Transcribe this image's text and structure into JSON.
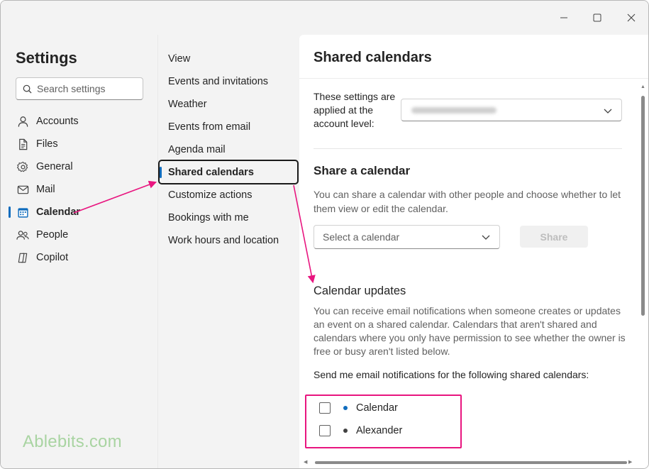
{
  "window": {
    "controls": [
      "minimize",
      "maximize",
      "close"
    ]
  },
  "settings": {
    "title": "Settings",
    "search_placeholder": "Search settings"
  },
  "nav": {
    "items": [
      {
        "label": "Accounts",
        "icon": "person-icon"
      },
      {
        "label": "Files",
        "icon": "file-icon"
      },
      {
        "label": "General",
        "icon": "gear-icon"
      },
      {
        "label": "Mail",
        "icon": "mail-icon"
      },
      {
        "label": "Calendar",
        "icon": "calendar-icon",
        "active": true
      },
      {
        "label": "People",
        "icon": "people-icon"
      },
      {
        "label": "Copilot",
        "icon": "copilot-icon"
      }
    ]
  },
  "subnav": {
    "items": [
      {
        "label": "View"
      },
      {
        "label": "Events and invitations"
      },
      {
        "label": "Weather"
      },
      {
        "label": "Events from email"
      },
      {
        "label": "Agenda mail"
      },
      {
        "label": "Shared calendars",
        "active": true
      },
      {
        "label": "Customize actions"
      },
      {
        "label": "Bookings with me"
      },
      {
        "label": "Work hours and location"
      }
    ]
  },
  "content": {
    "title": "Shared calendars",
    "account_label": "These settings are applied at the account level:",
    "share_heading": "Share a calendar",
    "share_text": "You can share a calendar with other people and choose whether to let them view or edit the calendar.",
    "select_placeholder": "Select a calendar",
    "share_button": "Share",
    "updates_heading": "Calendar updates",
    "updates_text": "You can receive email notifications when someone creates or updates an event on a shared calendar. Calendars that aren't shared and calendars where you only have permission to see whether the owner is free or busy aren't listed below.",
    "send_label": "Send me email notifications for the following shared calendars:",
    "calendars": [
      {
        "name": "Calendar",
        "color": "#0f6cbd",
        "checked": false
      },
      {
        "name": "Alexander",
        "color": "#424242",
        "checked": false
      }
    ]
  },
  "brand": {
    "text": "Ablebits.com"
  },
  "colors": {
    "accent": "#0f6cbd",
    "annotation": "#e8157f"
  }
}
